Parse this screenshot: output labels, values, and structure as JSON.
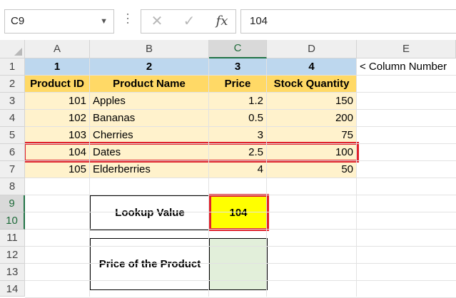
{
  "formula_bar": {
    "name_box": "C9",
    "name_box_dropdown_icon": "chevron-down-icon",
    "cancel_icon": "✕",
    "enter_icon": "✓",
    "fx_label": "fx",
    "formula": "104"
  },
  "columns": [
    "A",
    "B",
    "C",
    "D",
    "E"
  ],
  "rows": [
    "1",
    "2",
    "3",
    "4",
    "5",
    "6",
    "7",
    "8",
    "9",
    "10",
    "11",
    "12",
    "13",
    "14"
  ],
  "table": {
    "column_numbers": [
      "1",
      "2",
      "3",
      "4"
    ],
    "column_number_note": "< Column Number",
    "headers": [
      "Product ID",
      "Product Name",
      "Price",
      "Stock Quantity"
    ],
    "data": [
      [
        "101",
        "Apples",
        "1.2",
        "150"
      ],
      [
        "102",
        "Bananas",
        "0.5",
        "200"
      ],
      [
        "103",
        "Cherries",
        "3",
        "75"
      ],
      [
        "104",
        "Dates",
        "2.5",
        "100"
      ],
      [
        "105",
        "Elderberries",
        "4",
        "50"
      ]
    ]
  },
  "lookup": {
    "label": "Lookup Value",
    "value": "104",
    "result_label": "Price of the Product",
    "result_value": ""
  },
  "colors": {
    "column_number_fill": "#bdd7ee",
    "header_fill": "#ffd966",
    "data_fill": "#fff2cc",
    "highlight_border": "#e0202a",
    "lookup_value_fill": "#ffff00",
    "result_fill": "#e2efda",
    "selection": "#217346"
  }
}
